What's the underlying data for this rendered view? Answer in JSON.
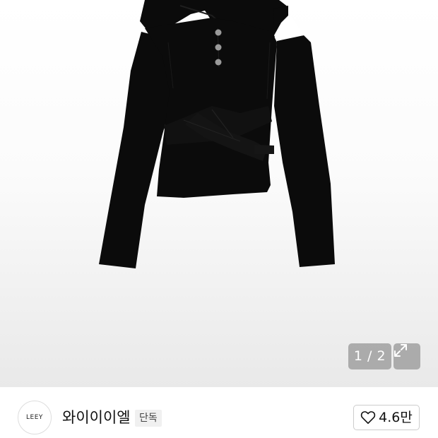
{
  "product": {
    "image": {
      "description_icon": "black-hooded-cutout-top"
    },
    "pager": {
      "text": "1 / 2"
    },
    "expand_icon": "expand-diagonal-icon"
  },
  "shop": {
    "logo_text": "LEEY",
    "name": "와이이이엘",
    "badge": "단독",
    "like": {
      "icon": "heart-outline-icon",
      "count": "4.6만"
    }
  },
  "colors": {
    "garment": "#0b0b0b",
    "overlay": "#969696",
    "border": "#cccccc"
  }
}
